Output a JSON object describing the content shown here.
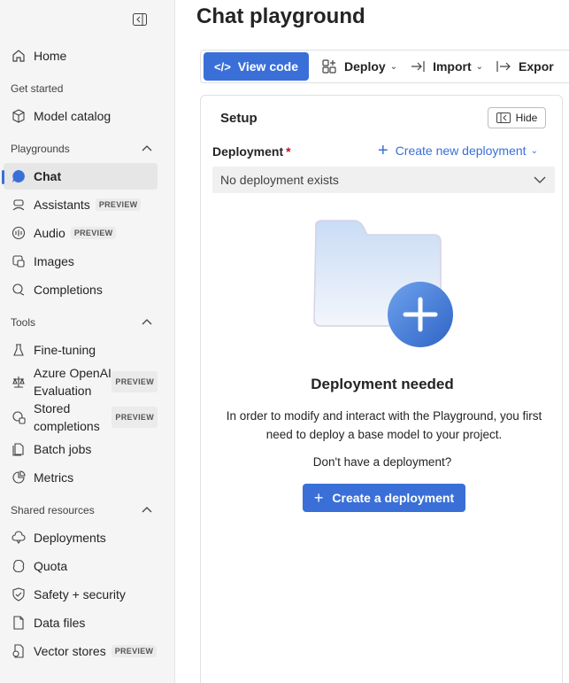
{
  "sidebar": {
    "items": {
      "home": "Home",
      "model_catalog": "Model catalog",
      "chat": "Chat",
      "assistants": "Assistants",
      "audio": "Audio",
      "images": "Images",
      "completions": "Completions",
      "fine_tuning": "Fine-tuning",
      "aoai_eval_line1": "Azure OpenAI",
      "aoai_eval_line2": "Evaluation",
      "stored_line1": "Stored",
      "stored_line2": "completions",
      "batch_jobs": "Batch jobs",
      "metrics": "Metrics",
      "deployments": "Deployments",
      "quota": "Quota",
      "safety": "Safety + security",
      "data_files": "Data files",
      "vector_stores": "Vector stores"
    },
    "sections": {
      "get_started": "Get started",
      "playgrounds": "Playgrounds",
      "tools": "Tools",
      "shared_resources": "Shared resources"
    },
    "preview_badge": "PREVIEW"
  },
  "main": {
    "title": "Chat playground",
    "toolbar": {
      "view_code": "View code",
      "deploy": "Deploy",
      "import": "Import",
      "export": "Expor"
    },
    "setup": {
      "title": "Setup",
      "hide": "Hide",
      "deployment_label": "Deployment",
      "required_mark": "*",
      "create_new": "Create new deployment",
      "select_value": "No deployment exists",
      "needed_title": "Deployment needed",
      "description": "In order to modify and interact with the Playground, you first need to deploy a base model to your project.",
      "prompt": "Don't have a deployment?",
      "create_button": "Create a deployment"
    }
  },
  "colors": {
    "accent": "#3a6fd8",
    "required": "#c50f1f",
    "sidebar_bg": "#f5f5f5"
  }
}
